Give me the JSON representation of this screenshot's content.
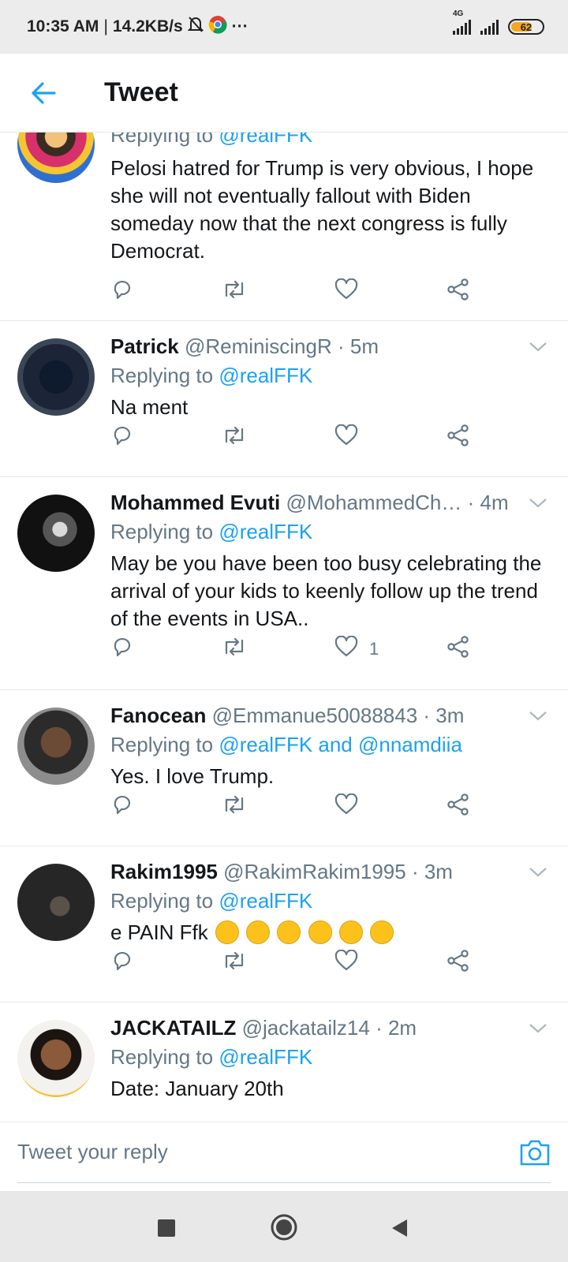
{
  "status_bar": {
    "time": "10:35 AM",
    "speed": "14.2KB/s",
    "more": "···",
    "network_type": "4G",
    "battery_level": "62"
  },
  "header": {
    "title": "Tweet"
  },
  "tweets": [
    {
      "name": "",
      "handle": "",
      "time": "",
      "replying_to": "Replying to ",
      "mention": "@realFFK",
      "text": "Pelosi hatred for Trump is very obvious, I hope she will not eventually fallout with Biden someday now that the next congress is fully Democrat.",
      "likes": ""
    },
    {
      "name": "Patrick",
      "handle": "@ReminiscingR",
      "time": "· 5m",
      "replying_to": "Replying to ",
      "mention": "@realFFK",
      "text": "Na ment",
      "likes": ""
    },
    {
      "name": "Mohammed Evuti",
      "handle": "@MohammedCh…",
      "time": "· 4m",
      "replying_to": "Replying to ",
      "mention": "@realFFK",
      "text": "May be you have been too busy celebrating the arrival of your kids to keenly follow up the trend of the events in USA..",
      "likes": "1"
    },
    {
      "name": "Fanocean",
      "handle": "@Emmanue50088843",
      "time": "· 3m",
      "replying_to": "Replying to ",
      "mention": "@realFFK and @nnamdiia",
      "text": "Yes.  I love Trump.",
      "likes": ""
    },
    {
      "name": "Rakim1995",
      "handle": "@RakimRakim1995",
      "time": "· 3m",
      "replying_to": "Replying to ",
      "mention": "@realFFK",
      "text": "e PAIN Ffk",
      "likes": ""
    },
    {
      "name": "JACKATAILZ",
      "handle": "@jackatailz14",
      "time": "· 2m",
      "replying_to": "Replying to ",
      "mention": "@realFFK",
      "text": "Date: January 20th",
      "likes": ""
    }
  ],
  "reply_bar": {
    "placeholder": "Tweet your reply"
  },
  "colors": {
    "accent": "#1da1f2",
    "muted": "#657786",
    "text": "#14171a"
  }
}
